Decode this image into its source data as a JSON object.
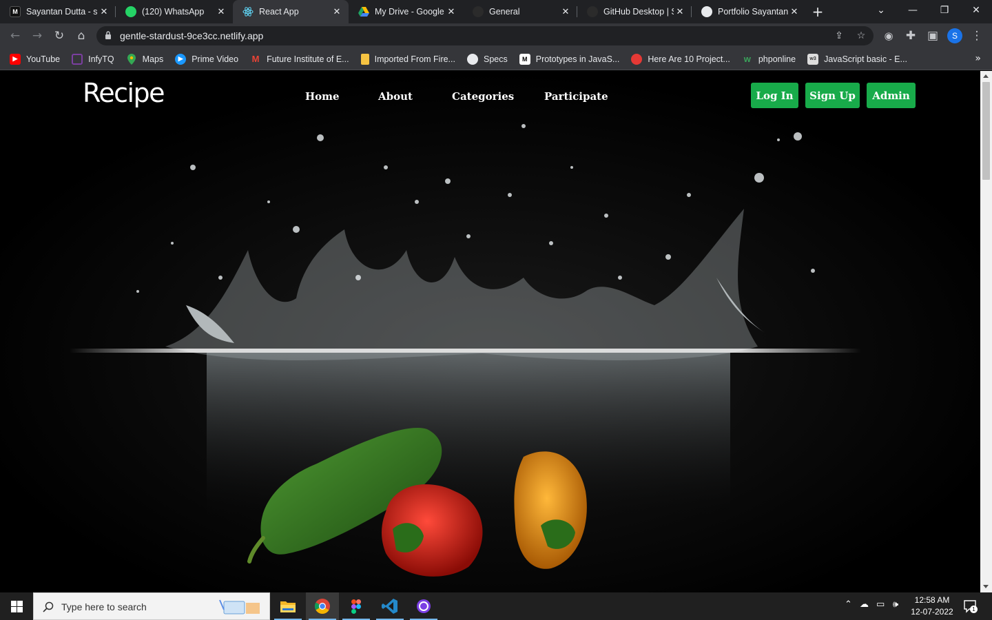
{
  "browser": {
    "tabs": [
      {
        "title": "Sayantan Dutta - sa",
        "icon": "medium-icon",
        "active": false
      },
      {
        "title": "(120) WhatsApp",
        "icon": "whatsapp-icon",
        "active": false
      },
      {
        "title": "React App",
        "icon": "react-icon",
        "active": true
      },
      {
        "title": "My Drive - Google",
        "icon": "google-drive-icon",
        "active": false
      },
      {
        "title": "General",
        "icon": "github-icon",
        "active": false
      },
      {
        "title": "GitHub Desktop | S",
        "icon": "github-icon",
        "active": false
      },
      {
        "title": "Portfolio Sayantan",
        "icon": "globe-icon",
        "active": false
      }
    ],
    "url": "gentle-stardust-9ce3cc.netlify.app",
    "profile_initial": "S",
    "bookmarks": [
      {
        "label": "YouTube",
        "icon": "youtube-icon",
        "color": "#ff0000"
      },
      {
        "label": "InfyTQ",
        "icon": "infytq-icon",
        "color": "#7b3fa0"
      },
      {
        "label": "Maps",
        "icon": "maps-icon",
        "color": "#34a853"
      },
      {
        "label": "Prime Video",
        "icon": "prime-video-icon",
        "color": "#1a98ff"
      },
      {
        "label": "Future Institute of E...",
        "icon": "gmail-icon",
        "color": "#ea4335"
      },
      {
        "label": "Imported From Fire...",
        "icon": "folder-icon",
        "color": "#f6c342"
      },
      {
        "label": "Specs",
        "icon": "globe-icon",
        "color": "#e8eaed"
      },
      {
        "label": "Prototypes in JavaS...",
        "icon": "medium-icon",
        "color": "#ffffff"
      },
      {
        "label": "Here Are 10 Project...",
        "icon": "dev-icon",
        "color": "#e53935"
      },
      {
        "label": "phponline",
        "icon": "w-icon",
        "color": "#3aa35b"
      },
      {
        "label": "JavaScript basic - E...",
        "icon": "w3resource-icon",
        "color": "#dddddd"
      }
    ]
  },
  "site": {
    "brand": "Recipe",
    "nav": [
      "Home",
      "About",
      "Categories",
      "Participate"
    ],
    "buttons": {
      "login": "Log In",
      "signup": "Sign Up",
      "admin": "Admin"
    },
    "accent_color": "#18ab4a"
  },
  "taskbar": {
    "search_placeholder": "Type here to search",
    "apps": [
      "file-explorer-icon",
      "chrome-icon",
      "figma-icon",
      "vscode-icon",
      "github-desktop-icon"
    ],
    "time": "12:58 AM",
    "date": "12-07-2022",
    "notification_count": "1"
  }
}
